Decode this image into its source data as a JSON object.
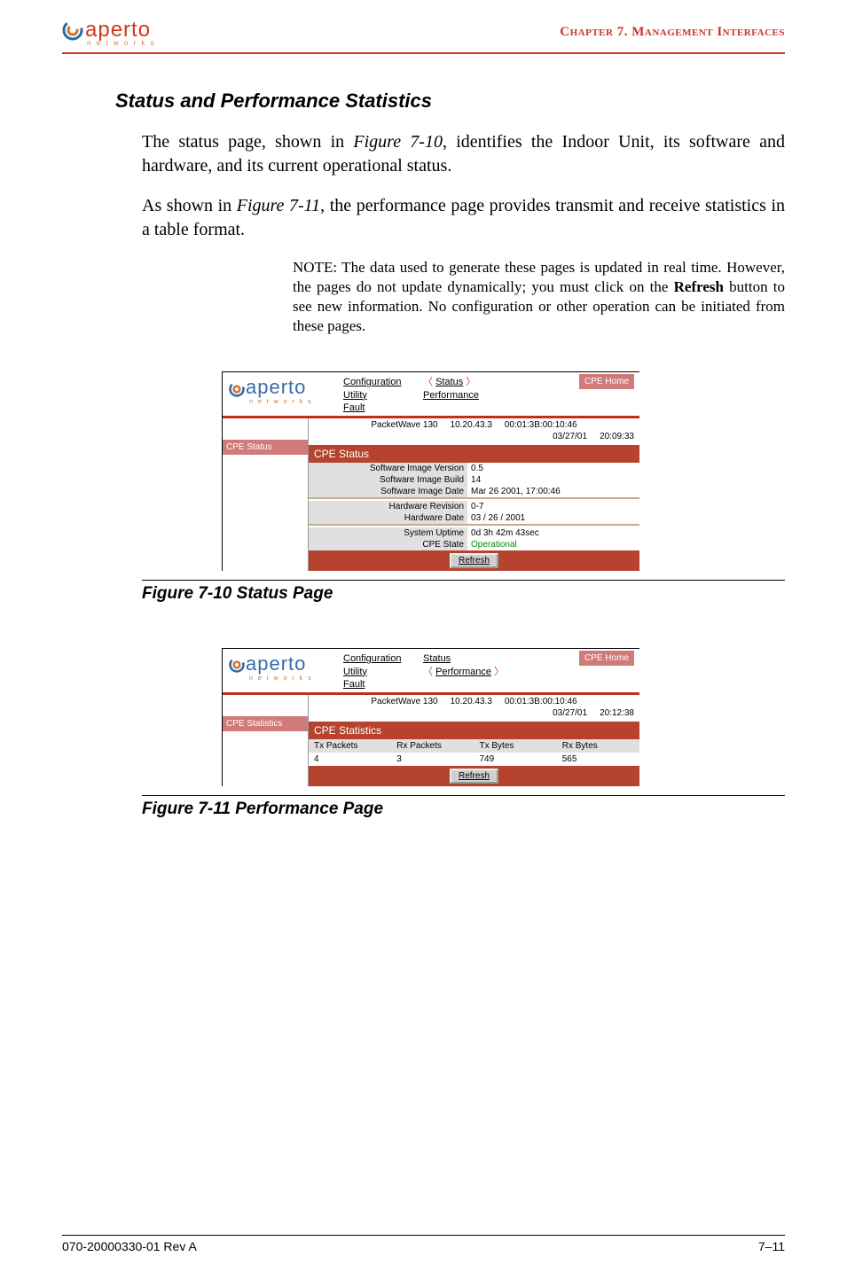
{
  "header": {
    "logo_text": "aperto",
    "logo_sub": "n e t w o r k s",
    "chapter": "Chapter 7.  Management Interfaces"
  },
  "section_heading": "Status and Performance Statistics",
  "para1_a": "The status page, shown in ",
  "para1_ref": "Figure 7-10",
  "para1_b": ", identifies the Indoor Unit, its software and hardware, and its current operational status.",
  "para2_a": "As shown in ",
  "para2_ref": "Figure 7-11",
  "para2_b": ", the performance page provides transmit and receive statis­tics in a table format.",
  "note_a": "NOTE:  The data used to generate these pages is updated in real time. However, the pages do not update dynamically; you must click on the ",
  "note_bold": "Refresh",
  "note_b": " button to see new information. No configuration or other operation can be initiated from these pages.",
  "fig1": {
    "logo": "aperto",
    "logo_sub": "n e t w o r k s",
    "nav": {
      "configuration": "Configuration",
      "utility": "Utility",
      "fault": "Fault",
      "status": "Status",
      "performance": "Performance"
    },
    "cpe_home": "CPE Home",
    "side_label": "CPE Status",
    "device": "PacketWave 130",
    "ip": "10.20.43.3",
    "mac": "00:01:3B:00:10:46",
    "date": "03/27/01",
    "time": "20:09:33",
    "panel_title": "CPE Status",
    "rows": {
      "siv_k": "Software Image Version",
      "siv_v": "0.5",
      "sib_k": "Software Image Build",
      "sib_v": "14",
      "sid_k": "Software Image Date",
      "sid_v": "Mar 26 2001, 17:00:46",
      "hr_k": "Hardware Revision",
      "hr_v": "0-7",
      "hd_k": "Hardware Date",
      "hd_v": "03 / 26 / 2001",
      "su_k": "System Uptime",
      "su_v": "0d 3h 42m 43sec",
      "cs_k": "CPE State",
      "cs_v": "Operational"
    },
    "refresh": "Refresh"
  },
  "fig1_caption": "Figure 7-10      Status Page",
  "fig2": {
    "logo": "aperto",
    "logo_sub": "n e t w o r k s",
    "nav": {
      "configuration": "Configuration",
      "utility": "Utility",
      "fault": "Fault",
      "status": "Status",
      "performance": "Performance"
    },
    "cpe_home": "CPE Home",
    "side_label": "CPE Statistics",
    "device": "PacketWave 130",
    "ip": "10.20.43.3",
    "mac": "00:01:3B:00:10:46",
    "date": "03/27/01",
    "time": "20:12:38",
    "panel_title": "CPE Statistics",
    "cols": {
      "c1": "Tx Packets",
      "c2": "Rx Packets",
      "c3": "Tx Bytes",
      "c4": "Rx Bytes"
    },
    "vals": {
      "v1": "4",
      "v2": "3",
      "v3": "749",
      "v4": "565"
    },
    "refresh": "Refresh"
  },
  "fig2_caption": "Figure 7-11      Performance Page",
  "footer": {
    "left": "070-20000330-01 Rev A",
    "right": "7–11"
  }
}
